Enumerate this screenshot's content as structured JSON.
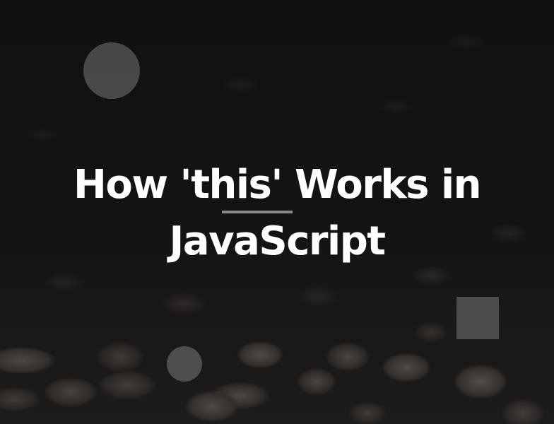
{
  "hero": {
    "title_line_1": "How 'this' Works in",
    "title_line_2": "JavaScript"
  },
  "colors": {
    "title_text": "#ffffff",
    "underline": "#8a8a8a",
    "decoration": "#bebebe",
    "background": "#141313"
  }
}
